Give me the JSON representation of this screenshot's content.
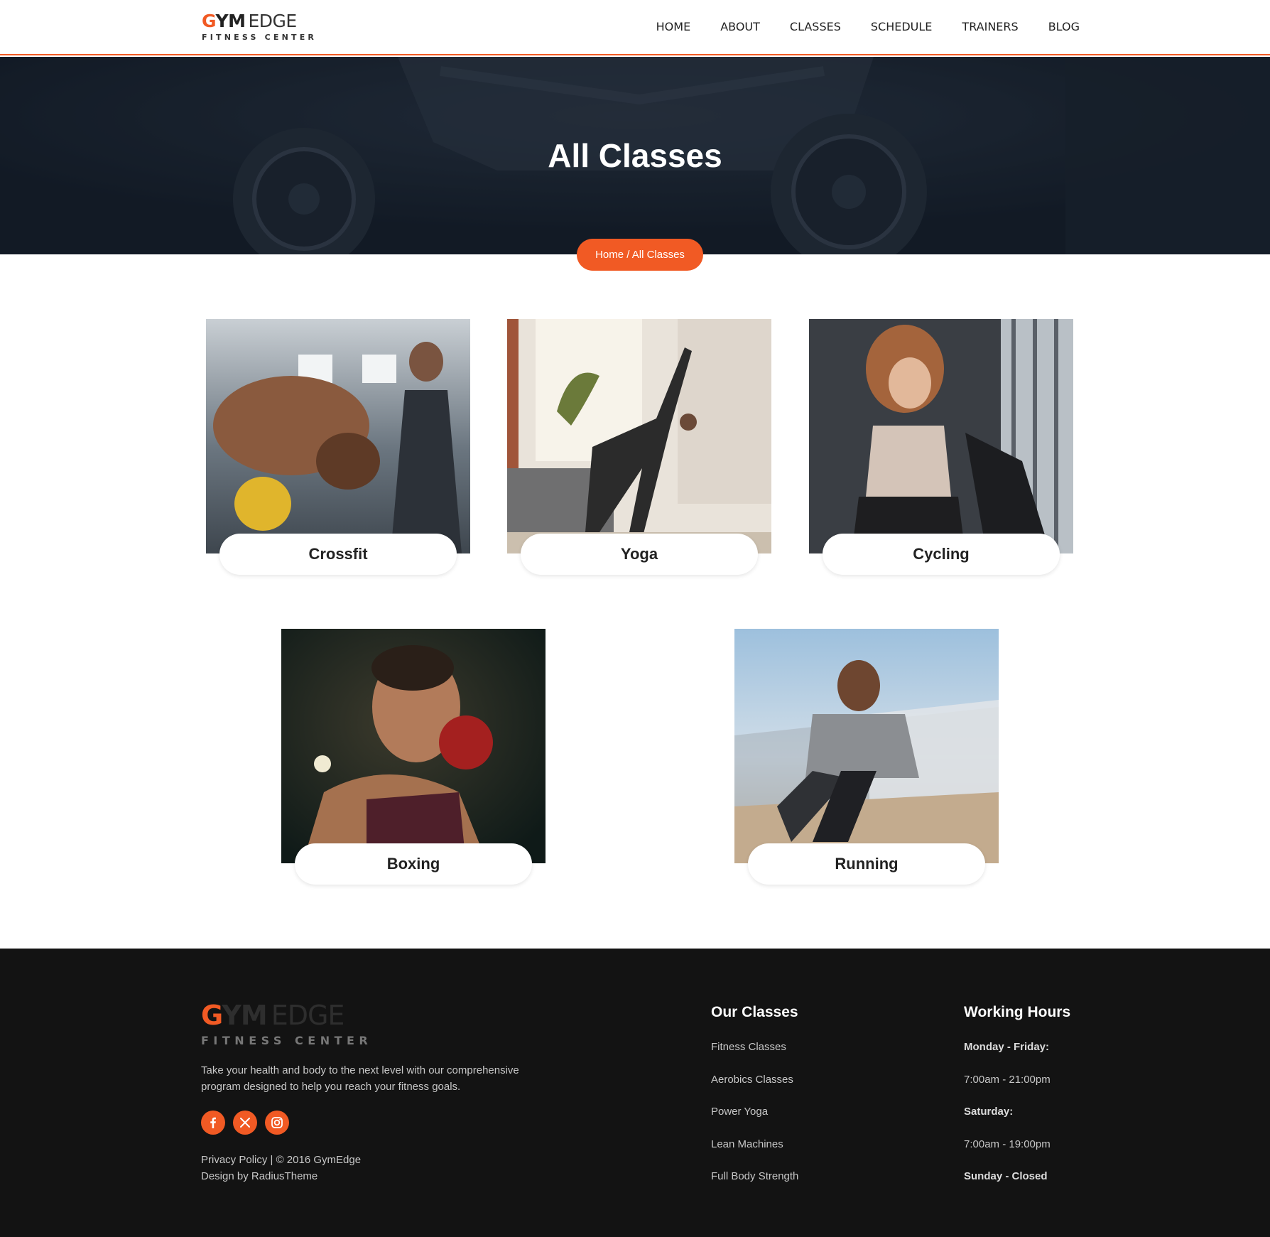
{
  "header": {
    "logo": {
      "g": "G",
      "ym": "YM",
      "edge": "EDGE",
      "subtitle": "FITNESS CENTER"
    },
    "nav": [
      "HOME",
      "ABOUT",
      "CLASSES",
      "SCHEDULE",
      "TRAINERS",
      "BLOG"
    ]
  },
  "hero": {
    "title": "All Classes",
    "breadcrumb": "Home / All Classes"
  },
  "classes": [
    {
      "name": "Crossfit"
    },
    {
      "name": "Yoga"
    },
    {
      "name": "Cycling"
    },
    {
      "name": "Boxing"
    },
    {
      "name": "Running"
    }
  ],
  "footer": {
    "logo": {
      "g": "G",
      "ym": "YM",
      "edge": "EDGE",
      "subtitle": "FITNESS CENTER"
    },
    "description": "Take your health and body to the next level with our comprehensive program designed to help you reach your fitness goals.",
    "copyright_line1": "Privacy Policy | © 2016 GymEdge",
    "copyright_line2": "Design by RadiusTheme",
    "socials": [
      "facebook-icon",
      "x-icon",
      "instagram-icon"
    ],
    "our_classes": {
      "title": "Our Classes",
      "items": [
        "Fitness Classes",
        "Aerobics Classes",
        "Power Yoga",
        "Lean Machines",
        "Full Body Strength"
      ]
    },
    "working_hours": {
      "title": "Working Hours",
      "items": [
        "Monday - Friday:",
        "7:00am - 21:00pm",
        "Saturday:",
        "7:00am - 19:00pm",
        "Sunday - Closed"
      ]
    }
  },
  "colors": {
    "accent": "#f15a24",
    "hero_bg": "#1a2230",
    "footer_bg": "#131313"
  }
}
